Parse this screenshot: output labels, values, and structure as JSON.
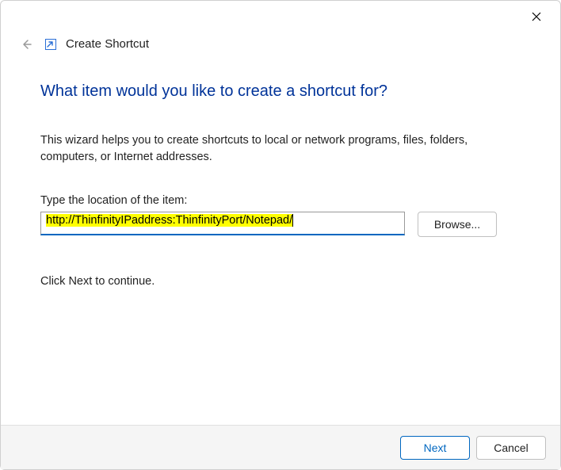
{
  "window": {
    "header_title": "Create Shortcut"
  },
  "main": {
    "heading": "What item would you like to create a shortcut for?",
    "description": "This wizard helps you to create shortcuts to local or network programs, files, folders, computers, or Internet addresses.",
    "field_label": "Type the location of the item:",
    "location_value": "http://ThinfinityIPaddress:ThinfinityPort/Notepad/",
    "browse_label": "Browse...",
    "continue_hint": "Click Next to continue."
  },
  "footer": {
    "next_label": "Next",
    "cancel_label": "Cancel"
  }
}
